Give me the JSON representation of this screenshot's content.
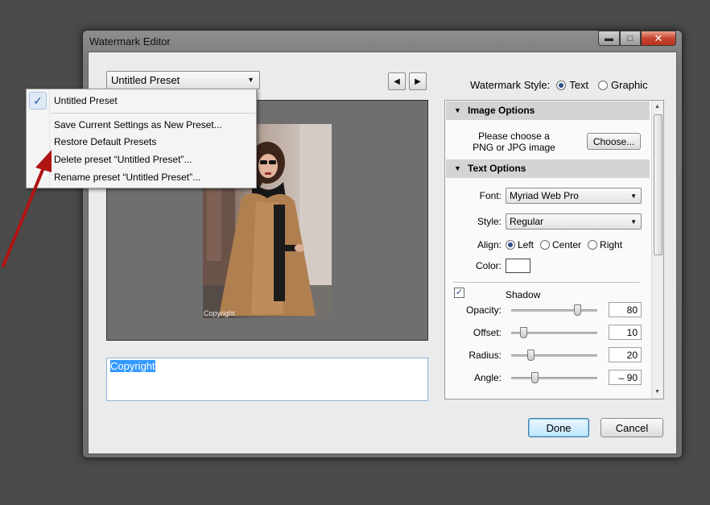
{
  "window": {
    "title": "Watermark Editor"
  },
  "preset": {
    "selected": "Untitled Preset",
    "menu_items": [
      "Untitled Preset",
      "Save Current Settings as New Preset...",
      "Restore Default Presets",
      "Delete preset “Untitled Preset”...",
      "Rename preset “Untitled Preset”..."
    ]
  },
  "watermark_style": {
    "label": "Watermark Style:",
    "options": [
      "Text",
      "Graphic"
    ],
    "selected": "Text"
  },
  "preview": {
    "watermark_text": "Copyright"
  },
  "text_input": {
    "value": "Copyright"
  },
  "image_options": {
    "header": "Image Options",
    "prompt_line1": "Please choose a",
    "prompt_line2": "PNG or JPG image",
    "choose_label": "Choose..."
  },
  "text_options": {
    "header": "Text Options",
    "font_label": "Font:",
    "font_value": "Myriad Web Pro",
    "style_label": "Style:",
    "style_value": "Regular",
    "align_label": "Align:",
    "align_options": [
      "Left",
      "Center",
      "Right"
    ],
    "align_selected": "Left",
    "color_label": "Color:",
    "color_value": "#ffffff"
  },
  "shadow": {
    "label": "Shadow",
    "checked": true,
    "opacity_label": "Opacity:",
    "opacity": "80",
    "offset_label": "Offset:",
    "offset": "10",
    "radius_label": "Radius:",
    "radius": "20",
    "angle_label": "Angle:",
    "angle": "– 90"
  },
  "footer": {
    "done_label": "Done",
    "cancel_label": "Cancel"
  },
  "annotation": {
    "arrow_color": "#b01414"
  }
}
